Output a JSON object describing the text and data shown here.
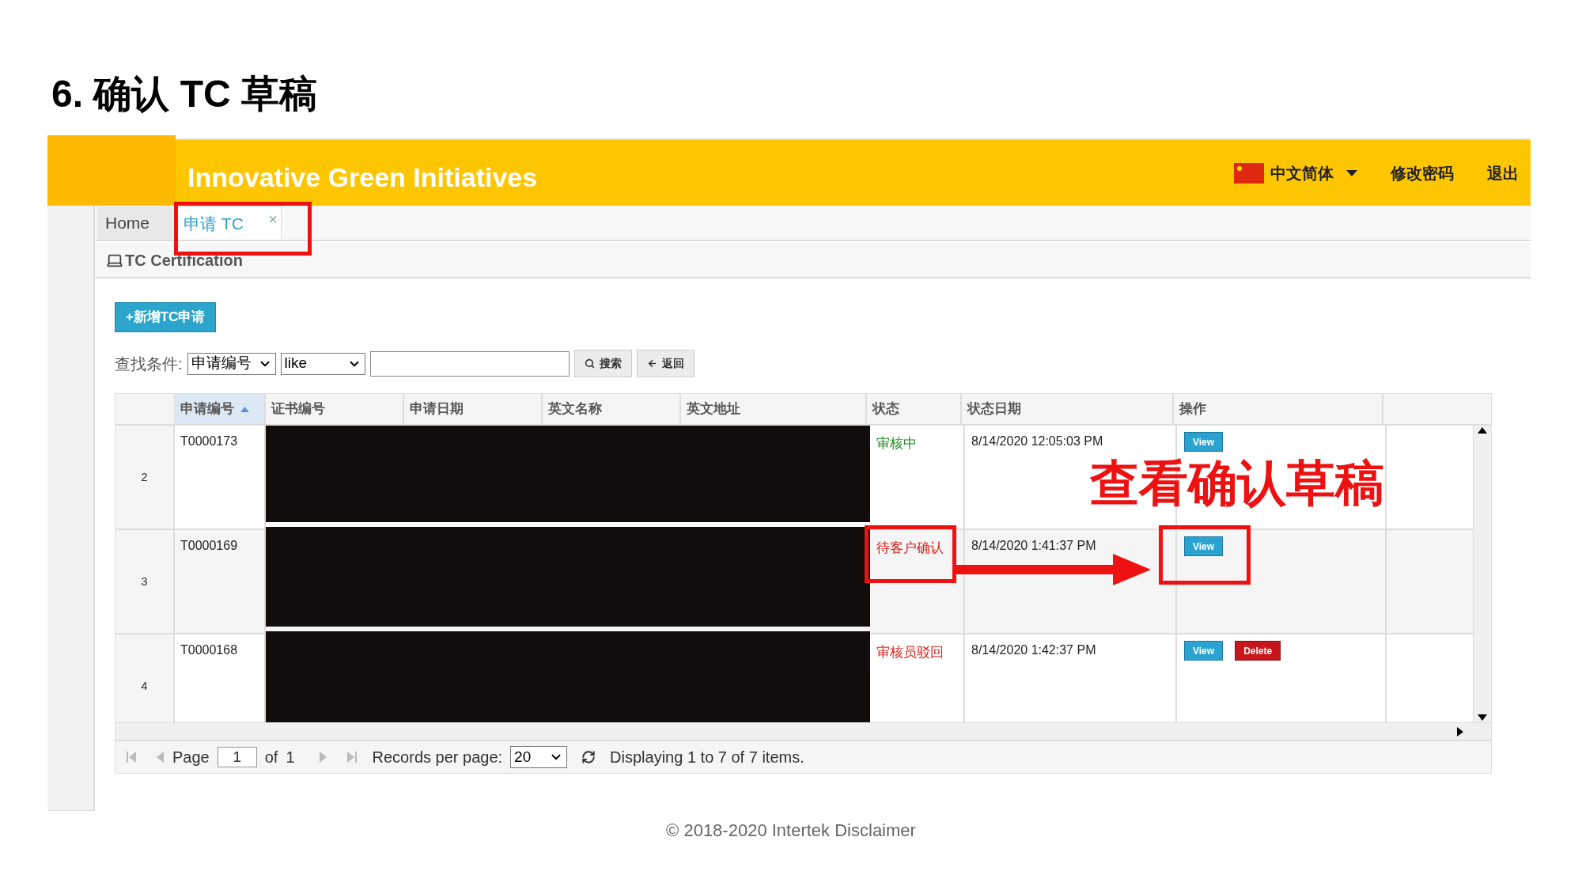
{
  "slide_title": "6. 确认 TC 草稿",
  "header": {
    "brand": "Innovative Green Initiatives",
    "language": "中文简体",
    "links": [
      "修改密码",
      "退出"
    ]
  },
  "tabs": [
    {
      "label": "Home",
      "selected": false
    },
    {
      "label": "申请 TC",
      "selected": true,
      "close_glyph": "×"
    }
  ],
  "panel": {
    "title": "TC Certification"
  },
  "add_button": "+新增TC申请",
  "search": {
    "label": "查找条件:",
    "field": "申请编号",
    "operator": "like",
    "buttons": [
      {
        "kind": "search",
        "label": "搜索"
      },
      {
        "kind": "back",
        "label": "返回"
      }
    ]
  },
  "table": {
    "columns": [
      {
        "label": "申请编号",
        "sorted": true
      },
      {
        "label": "证书编号",
        "sorted": false
      },
      {
        "label": "申请日期",
        "sorted": false
      },
      {
        "label": "英文名称",
        "sorted": false
      },
      {
        "label": "英文地址",
        "sorted": false
      },
      {
        "label": "状态",
        "sorted": false
      },
      {
        "label": "状态日期",
        "sorted": false
      },
      {
        "label": "操作",
        "sorted": false
      }
    ],
    "rows": [
      {
        "number": "2",
        "id": "T0000173",
        "status": "审核中",
        "color": "#228b22",
        "status_date": "8/14/2020 12:05:03 PM",
        "actions": [
          {
            "kind": "view",
            "label": "View"
          }
        ]
      },
      {
        "number": "3",
        "id": "T0000169",
        "status": "待客户确认",
        "color": "#e0201b",
        "status_date": "8/14/2020 1:41:37 PM",
        "actions": [
          {
            "kind": "view",
            "label": "View"
          }
        ]
      },
      {
        "number": "4",
        "id": "T0000168",
        "status": "审核员驳回",
        "color": "#e0201b",
        "status_date": "8/14/2020 1:42:37 PM",
        "actions": [
          {
            "kind": "view",
            "label": "View"
          },
          {
            "kind": "delete",
            "label": "Delete"
          }
        ]
      }
    ]
  },
  "pager": {
    "page_label": "Page",
    "page": "1",
    "of_label": "of",
    "total_pages": "1",
    "records_label": "Records per page:",
    "records": "20",
    "display": "Displaying 1 to 7 of 7 items."
  },
  "annotation": {
    "text": "查看确认草稿"
  },
  "footer": "© 2018-2020 Intertek Disclaimer"
}
